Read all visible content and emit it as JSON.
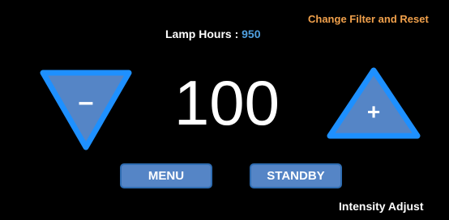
{
  "header": {
    "change_filter_link": "Change Filter and Reset",
    "lamp_hours_label": "Lamp Hours",
    "lamp_hours_sep": ":",
    "lamp_hours_value": "950"
  },
  "control": {
    "level_value": "100",
    "decrease_symbol": "–",
    "decrease_icon": "triangle-down-minus-icon",
    "increase_symbol": "+",
    "increase_icon": "triangle-up-plus-icon"
  },
  "buttons": {
    "menu_label": "MENU",
    "standby_label": "STANDBY"
  },
  "footer": {
    "mode_label": "Intensity Adjust"
  },
  "colors": {
    "background": "#000000",
    "accent_link": "#f0a04b",
    "value_blue": "#4fa0e0",
    "triangle_fill": "#5585c6",
    "triangle_stroke": "#1e90ff",
    "button_fill": "#5585c6"
  }
}
